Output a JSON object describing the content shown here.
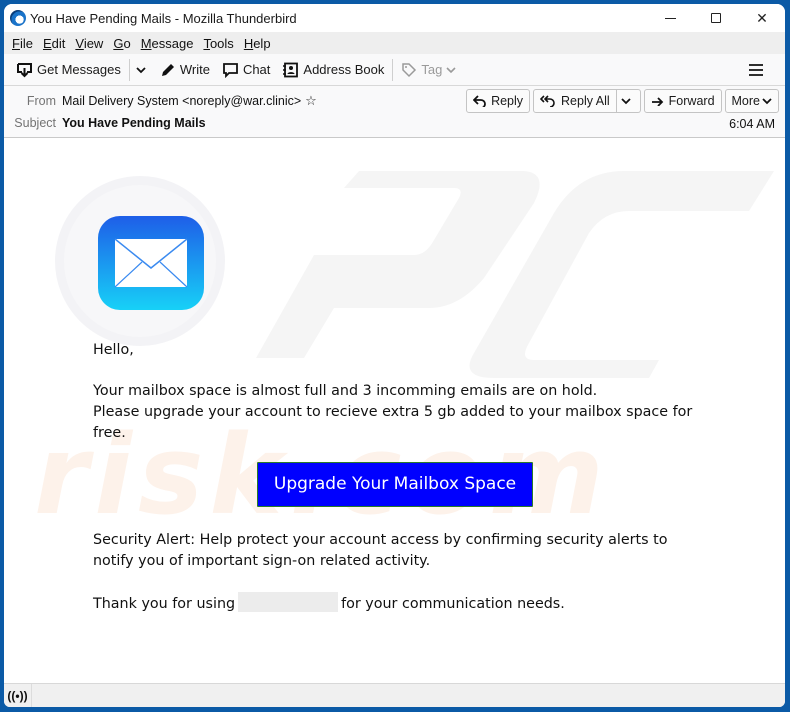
{
  "window": {
    "title": "You Have Pending Mails - Mozilla Thunderbird",
    "controls": {
      "minimize": "minimize",
      "maximize": "maximize",
      "close": "✕"
    }
  },
  "menubar": {
    "items": [
      {
        "label": "File",
        "mnemonic": "F",
        "rest": "ile"
      },
      {
        "label": "Edit",
        "mnemonic": "E",
        "rest": "dit"
      },
      {
        "label": "View",
        "mnemonic": "V",
        "rest": "iew"
      },
      {
        "label": "Go",
        "mnemonic": "G",
        "rest": "o"
      },
      {
        "label": "Message",
        "mnemonic": "M",
        "rest": "essage"
      },
      {
        "label": "Tools",
        "mnemonic": "T",
        "rest": "ools"
      },
      {
        "label": "Help",
        "mnemonic": "H",
        "rest": "elp"
      }
    ]
  },
  "toolbar": {
    "get_messages": "Get Messages",
    "write": "Write",
    "chat": "Chat",
    "address_book": "Address Book",
    "tag": "Tag",
    "menu_icon": "≡"
  },
  "header": {
    "from_label": "From",
    "from_value": "Mail Delivery System <noreply@war.clinic>",
    "subject_label": "Subject",
    "subject_value": "You Have Pending Mails",
    "time": "6:04 AM",
    "actions": {
      "reply": "Reply",
      "reply_all": "Reply All",
      "forward": "Forward",
      "more": "More"
    }
  },
  "body": {
    "greeting": "Hello,",
    "paragraph_1_line_1": "Your mailbox space is almost full and 3 incomming emails are on hold.",
    "paragraph_1_line_2": "Please upgrade your account to recieve extra 5 gb added to your mailbox space for free.",
    "cta_label": "Upgrade Your Mailbox Space",
    "security_alert": "Security Alert: Help protect your account access by confirming security alerts to notify you of important sign-on related activity.",
    "thanks_before": "Thank you for using",
    "thanks_after": "for your communication needs."
  },
  "colors": {
    "cta_background": "#0000ff",
    "cta_text": "#ffffff",
    "window_frame": "#0b5aa6"
  }
}
